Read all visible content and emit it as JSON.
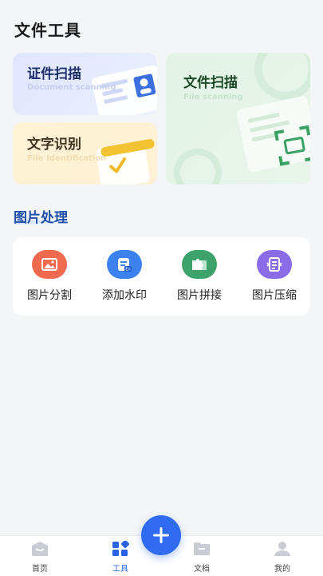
{
  "header": {
    "title": "文件工具"
  },
  "cards": {
    "id_scan": {
      "title": "证件扫描",
      "subtitle": "Document scanning"
    },
    "text_recognition": {
      "title": "文字识别",
      "subtitle": "File Identification"
    },
    "file_scan": {
      "title": "文件扫描",
      "subtitle": "File scanning"
    }
  },
  "image_processing": {
    "section_title": "图片处理",
    "tools": [
      {
        "label": "图片分割",
        "icon": "image-icon",
        "color": "#ef6a4e"
      },
      {
        "label": "添加水印",
        "icon": "document-en-icon",
        "color": "#3b82ef"
      },
      {
        "label": "图片拼接",
        "icon": "puzzle-icon",
        "color": "#3da36a"
      },
      {
        "label": "图片压缩",
        "icon": "compress-icon",
        "color": "#8a6ce8"
      }
    ]
  },
  "tabbar": {
    "tabs": [
      {
        "label": "首页",
        "icon": "home-icon"
      },
      {
        "label": "工具",
        "icon": "tools-icon",
        "active": true
      },
      {
        "label": "文档",
        "icon": "folder-icon"
      },
      {
        "label": "我的",
        "icon": "user-icon"
      }
    ],
    "fab_icon": "plus-icon"
  },
  "colors": {
    "accent": "#2f6cf2",
    "section_title": "#1f4fa8"
  }
}
